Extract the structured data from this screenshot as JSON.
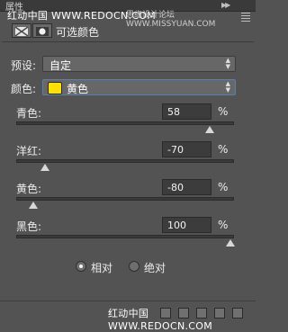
{
  "header": {
    "tab_title": "属性",
    "watermark_left": "红动中国 WWW.REDOCN.COM",
    "watermark_right": "思缘设计论坛 WWW.MISSYUAN.COM"
  },
  "panel": {
    "title": "可选颜色",
    "icons": [
      "selective-color-adjustment-icon",
      "layer-mask-icon"
    ]
  },
  "preset": {
    "label": "预设:",
    "value": "自定"
  },
  "colors": {
    "label": "颜色:",
    "value": "黄色",
    "swatch_color": "#ffe000"
  },
  "sliders": [
    {
      "label": "青色:",
      "value": "58",
      "unit": "%",
      "level_percent": 58
    },
    {
      "label": "洋红:",
      "value": "-70",
      "unit": "%",
      "level_percent": -70
    },
    {
      "label": "黄色:",
      "value": "-80",
      "unit": "%",
      "level_percent": -80
    },
    {
      "label": "黑色:",
      "value": "100",
      "unit": "%",
      "level_percent": 100
    }
  ],
  "method": {
    "options": [
      {
        "label": "相对",
        "selected": true
      },
      {
        "label": "绝对",
        "selected": false
      }
    ]
  },
  "footer": {
    "watermark": "红动中国 WWW.REDOCN.COM",
    "icons": [
      "clip-to-layer-icon",
      "view-previous-state-icon",
      "reset-icon",
      "visibility-eye-icon",
      "delete-trash-icon"
    ]
  }
}
